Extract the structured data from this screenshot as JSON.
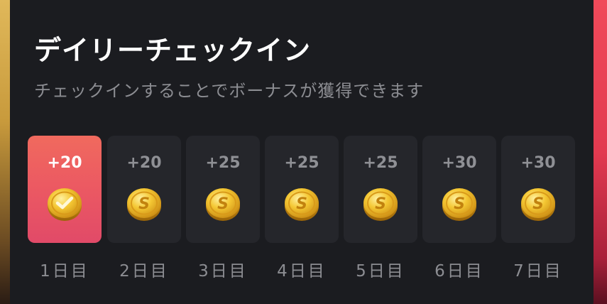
{
  "title": "デイリーチェックイン",
  "subtitle": "チェックインすることでボーナスが獲得できます",
  "days": [
    {
      "reward": "+20",
      "label": "1日目",
      "status": "checked",
      "icon": "check-coin-icon"
    },
    {
      "reward": "+20",
      "label": "2日目",
      "status": "pending",
      "icon": "coin-icon"
    },
    {
      "reward": "+25",
      "label": "3日目",
      "status": "pending",
      "icon": "coin-icon"
    },
    {
      "reward": "+25",
      "label": "4日目",
      "status": "pending",
      "icon": "coin-icon"
    },
    {
      "reward": "+25",
      "label": "5日目",
      "status": "pending",
      "icon": "coin-icon"
    },
    {
      "reward": "+30",
      "label": "6日目",
      "status": "pending",
      "icon": "coin-icon"
    },
    {
      "reward": "+30",
      "label": "7日目",
      "status": "pending",
      "icon": "coin-icon"
    }
  ],
  "colors": {
    "card_bg": "#1b1c20",
    "tile_bg": "#25262b",
    "active_gradient_top": "#f06a5e",
    "active_gradient_bottom": "#e14a68",
    "coin_gold": "#f2c230",
    "muted_text": "#8c8d92"
  }
}
